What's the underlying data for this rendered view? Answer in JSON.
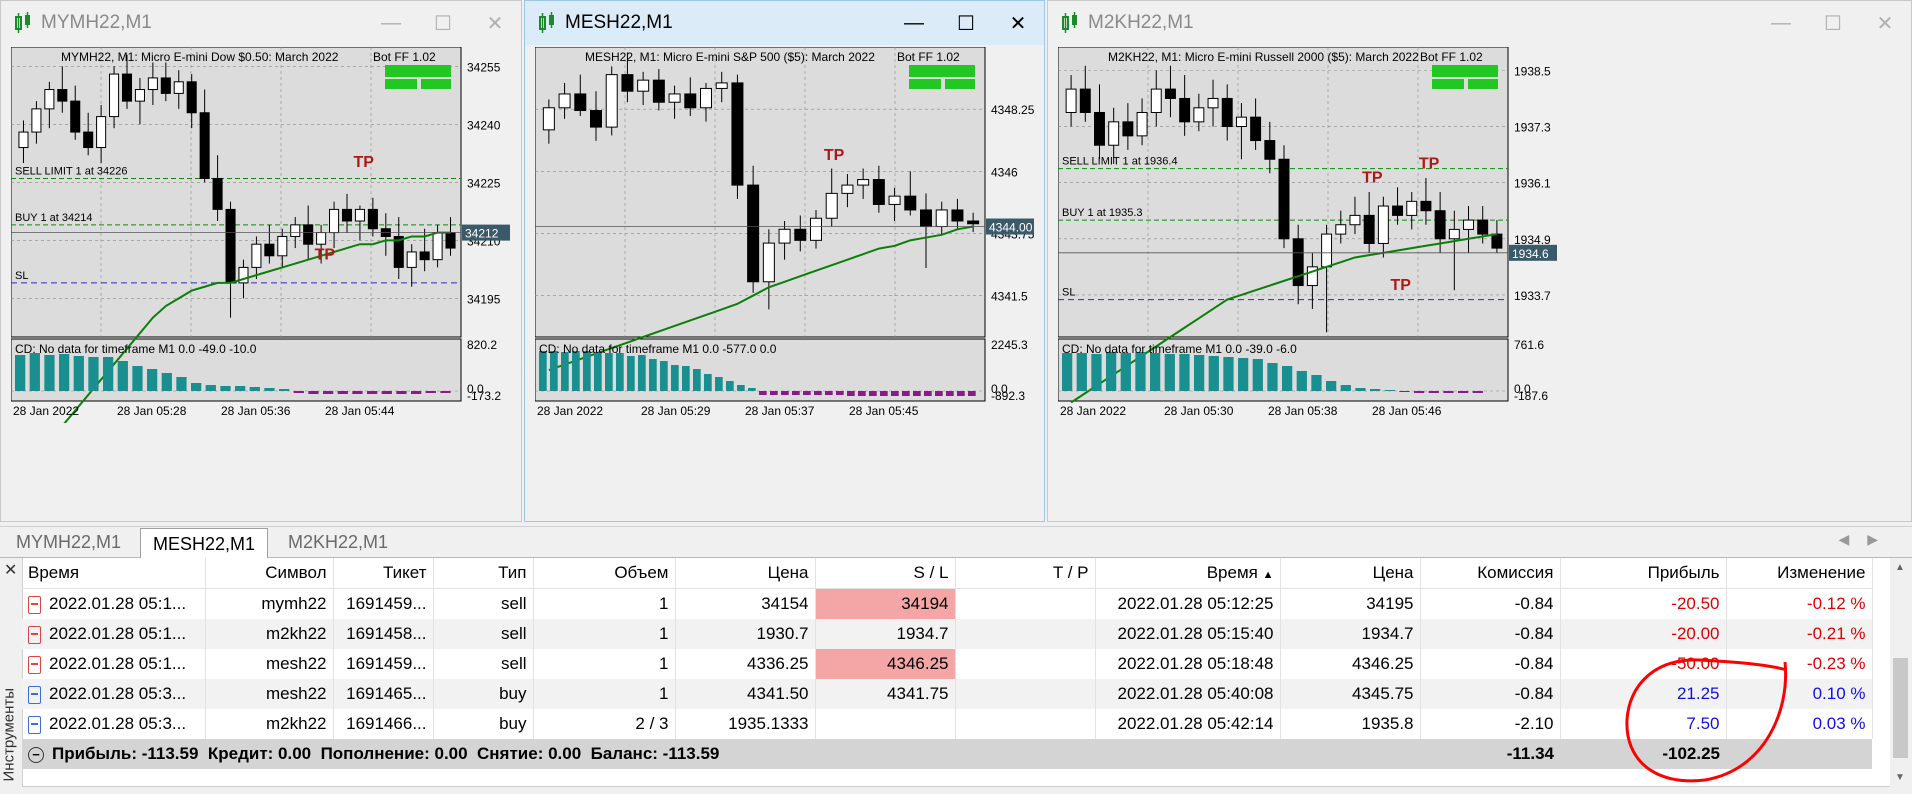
{
  "windows": [
    {
      "title": "MYMH22,M1",
      "active": false,
      "header": "MYMH22, M1:  Micro E-mini Dow $0.50: March 2022",
      "bot": "Bot FF 1.02",
      "levels": [
        {
          "label": "SELL LIMIT 1 at 34226",
          "price": 34226
        },
        {
          "label": "BUY 1 at 34214",
          "price": 34214
        },
        {
          "label": "SL",
          "price": 34199
        }
      ],
      "price_axis": {
        "min": 34185,
        "max": 34260,
        "ticks": [
          34255,
          34240,
          34225,
          34210,
          34195
        ],
        "current": "34212",
        "current_value": 34212
      },
      "tp_markers": [
        {
          "text": "TP",
          "price": 34229,
          "idx": 26
        },
        {
          "text": "TP",
          "price": 34205,
          "idx": 23
        }
      ],
      "indicator_label": "CD: No data for timeframe M1 0.0 -49.0 -10.0",
      "indicator_axis": {
        "top": "820.2",
        "mid": "0.0",
        "bottom": "-173.2"
      },
      "time_labels": [
        "28 Jan 2022",
        "28 Jan 05:28",
        "28 Jan 05:36",
        "28 Jan 05:44"
      ],
      "candles": [
        [
          34234,
          34241,
          34230,
          34238
        ],
        [
          34238,
          34246,
          34235,
          34244
        ],
        [
          34244,
          34251,
          34239,
          34249
        ],
        [
          34249,
          34255,
          34243,
          34246
        ],
        [
          34246,
          34250,
          34236,
          34238
        ],
        [
          34238,
          34243,
          34232,
          34234
        ],
        [
          34234,
          34245,
          34230,
          34242
        ],
        [
          34242,
          34255,
          34239,
          34253
        ],
        [
          34253,
          34258,
          34244,
          34246
        ],
        [
          34246,
          34252,
          34240,
          34249
        ],
        [
          34249,
          34256,
          34245,
          34252
        ],
        [
          34252,
          34256,
          34246,
          34248
        ],
        [
          34248,
          34254,
          34244,
          34251
        ],
        [
          34251,
          34253,
          34239,
          34243
        ],
        [
          34243,
          34249,
          34225,
          34226
        ],
        [
          34226,
          34232,
          34215,
          34218
        ],
        [
          34218,
          34220,
          34190,
          34199
        ],
        [
          34199,
          34205,
          34195,
          34203
        ],
        [
          34203,
          34211,
          34200,
          34209
        ],
        [
          34209,
          34214,
          34204,
          34206
        ],
        [
          34206,
          34213,
          34203,
          34211
        ],
        [
          34211,
          34216,
          34208,
          34214
        ],
        [
          34214,
          34219,
          34205,
          34209
        ],
        [
          34209,
          34214,
          34204,
          34212
        ],
        [
          34212,
          34220,
          34208,
          34218
        ],
        [
          34218,
          34222,
          34212,
          34215
        ],
        [
          34215,
          34219,
          34210,
          34218
        ],
        [
          34218,
          34221,
          34211,
          34213
        ],
        [
          34213,
          34217,
          34206,
          34211
        ],
        [
          34211,
          34216,
          34200,
          34203
        ],
        [
          34203,
          34209,
          34198,
          34207
        ],
        [
          34207,
          34213,
          34202,
          34205
        ],
        [
          34205,
          34214,
          34203,
          34212
        ],
        [
          34212,
          34216,
          34206,
          34208
        ]
      ],
      "ma": [
        34150,
        34154,
        34158,
        34162,
        34166,
        34170,
        34174,
        34178,
        34182,
        34186,
        34190,
        34193,
        34195,
        34197,
        34198,
        34199,
        34199,
        34200,
        34201,
        34202,
        34203,
        34204,
        34205,
        34206,
        34207,
        34208,
        34209,
        34209,
        34210,
        34210,
        34211,
        34211,
        34212,
        34212
      ],
      "histogram": [
        36,
        38,
        36,
        37,
        35,
        34,
        34,
        30,
        25,
        22,
        18,
        14,
        8,
        6,
        5,
        5,
        4,
        3,
        2,
        -2,
        -3,
        -3,
        -3,
        -3,
        -3,
        -3,
        -3,
        -3,
        -2,
        -2
      ]
    },
    {
      "title": "MESH22,M1",
      "active": true,
      "header": "MESH22, M1:  Micro E-mini S&P 500 ($5): March 2022",
      "bot": "Bot FF 1.02",
      "levels": [],
      "price_axis": {
        "min": 4340.0,
        "max": 4350.5,
        "ticks": [
          4348.25,
          4346.0,
          4343.75,
          4341.5
        ],
        "current": "4344.00",
        "current_value": 4344.0
      },
      "tp_markers": [
        {
          "text": "TP",
          "price": 4346.4,
          "idx": 18
        }
      ],
      "indicator_label": "CD: No data for timeframe M1 0.0 -577.0 0.0",
      "indicator_axis": {
        "top": "2245.3",
        "mid": "0.0",
        "bottom": "-892.3"
      },
      "time_labels": [
        "28 Jan 2022",
        "28 Jan 05:29",
        "28 Jan 05:37",
        "28 Jan 05:45"
      ],
      "candles": [
        [
          4347.5,
          4348.6,
          4347.0,
          4348.3
        ],
        [
          4348.3,
          4349.2,
          4347.9,
          4348.8
        ],
        [
          4348.8,
          4349.5,
          4348.0,
          4348.2
        ],
        [
          4348.2,
          4348.9,
          4347.1,
          4347.6
        ],
        [
          4347.6,
          4349.8,
          4347.3,
          4349.5
        ],
        [
          4349.5,
          4350.3,
          4348.5,
          4348.9
        ],
        [
          4348.9,
          4349.6,
          4348.4,
          4349.3
        ],
        [
          4349.3,
          4349.7,
          4348.2,
          4348.5
        ],
        [
          4348.5,
          4349.1,
          4347.9,
          4348.8
        ],
        [
          4348.8,
          4349.4,
          4348.0,
          4348.3
        ],
        [
          4348.3,
          4349.2,
          4347.8,
          4349.0
        ],
        [
          4349.0,
          4349.6,
          4348.5,
          4349.2
        ],
        [
          4349.2,
          4349.5,
          4345.0,
          4345.5
        ],
        [
          4345.5,
          4346.2,
          4341.6,
          4342.0
        ],
        [
          4342.0,
          4343.9,
          4341.0,
          4343.4
        ],
        [
          4343.4,
          4344.2,
          4342.8,
          4343.9
        ],
        [
          4343.9,
          4344.4,
          4343.1,
          4343.5
        ],
        [
          4343.5,
          4344.6,
          4343.2,
          4344.3
        ],
        [
          4344.3,
          4346.1,
          4344.0,
          4345.2
        ],
        [
          4345.2,
          4345.9,
          4344.7,
          4345.5
        ],
        [
          4345.5,
          4346.1,
          4345.0,
          4345.7
        ],
        [
          4345.7,
          4346.2,
          4344.5,
          4344.8
        ],
        [
          4344.8,
          4345.4,
          4344.2,
          4345.1
        ],
        [
          4345.1,
          4346.0,
          4344.4,
          4344.6
        ],
        [
          4344.6,
          4345.2,
          4342.5,
          4344.0
        ],
        [
          4344.0,
          4344.9,
          4343.7,
          4344.6
        ],
        [
          4344.6,
          4345.0,
          4343.9,
          4344.2
        ],
        [
          4344.2,
          4344.5,
          4343.8,
          4344.1
        ]
      ],
      "ma": [
        4338.8,
        4339.0,
        4339.2,
        4339.4,
        4339.6,
        4339.8,
        4340.0,
        4340.2,
        4340.4,
        4340.6,
        4340.8,
        4341.0,
        4341.2,
        4341.5,
        4341.8,
        4342.0,
        4342.2,
        4342.4,
        4342.6,
        4342.8,
        4343.0,
        4343.2,
        4343.3,
        4343.5,
        4343.6,
        4343.7,
        4343.9,
        4344.0
      ],
      "histogram": [
        40,
        40,
        39,
        40,
        40,
        39,
        38,
        38,
        35,
        36,
        32,
        30,
        26,
        25,
        22,
        17,
        14,
        10,
        6,
        3,
        -4,
        -4,
        -4,
        -4,
        -4,
        -4,
        -4,
        -4,
        -5,
        -5,
        -5,
        -5,
        -5,
        -5,
        -5,
        -5,
        -5,
        -5,
        -5,
        -5
      ]
    },
    {
      "title": "M2KH22,M1",
      "active": false,
      "header": "M2KH22, M1:  Micro E-mini Russell 2000 ($5): March 2022",
      "bot": "Bot FF 1.02",
      "levels": [
        {
          "label": "SELL LIMIT 1 at 1936.4",
          "price": 1936.4
        },
        {
          "label": "BUY 1 at 1935.3",
          "price": 1935.3
        },
        {
          "label": "SL",
          "price": 1933.6
        }
      ],
      "price_axis": {
        "min": 1932.8,
        "max": 1939.0,
        "ticks": [
          1938.5,
          1937.3,
          1936.1,
          1934.9,
          1933.7
        ],
        "current": "1934.6",
        "current_value": 1934.6
      },
      "tp_markers": [
        {
          "text": "TP",
          "price": 1936.1,
          "idx": 21
        },
        {
          "text": "TP",
          "price": 1936.4,
          "idx": 25
        },
        {
          "text": "TP",
          "price": 1933.8,
          "idx": 23
        }
      ],
      "indicator_label": "CD: No data for timeframe M1 0.0 -39.0 -6.0",
      "indicator_axis": {
        "top": "761.6",
        "mid": "0.0",
        "bottom": "-187.6"
      },
      "time_labels": [
        "28 Jan 2022",
        "28 Jan 05:30",
        "28 Jan 05:38",
        "28 Jan 05:46"
      ],
      "candles": [
        [
          1937.6,
          1938.4,
          1937.3,
          1938.1
        ],
        [
          1938.1,
          1938.6,
          1937.4,
          1937.6
        ],
        [
          1937.6,
          1938.2,
          1936.6,
          1936.9
        ],
        [
          1936.9,
          1937.7,
          1936.5,
          1937.4
        ],
        [
          1937.4,
          1937.8,
          1936.8,
          1937.1
        ],
        [
          1937.1,
          1937.9,
          1936.9,
          1937.6
        ],
        [
          1937.6,
          1938.5,
          1937.3,
          1938.1
        ],
        [
          1938.1,
          1938.6,
          1937.5,
          1937.9
        ],
        [
          1937.9,
          1938.4,
          1937.1,
          1937.4
        ],
        [
          1937.4,
          1938.0,
          1937.2,
          1937.7
        ],
        [
          1937.7,
          1938.3,
          1937.3,
          1937.9
        ],
        [
          1937.9,
          1938.2,
          1937.0,
          1937.3
        ],
        [
          1937.3,
          1937.8,
          1936.6,
          1937.5
        ],
        [
          1937.5,
          1937.9,
          1936.8,
          1937.0
        ],
        [
          1937.0,
          1937.4,
          1936.3,
          1936.6
        ],
        [
          1936.6,
          1936.9,
          1934.7,
          1934.9
        ],
        [
          1934.9,
          1935.2,
          1933.5,
          1933.9
        ],
        [
          1933.9,
          1934.6,
          1933.4,
          1934.3
        ],
        [
          1934.3,
          1935.2,
          1932.9,
          1935.0
        ],
        [
          1935.0,
          1935.5,
          1934.8,
          1935.2
        ],
        [
          1935.2,
          1935.8,
          1935.0,
          1935.4
        ],
        [
          1935.4,
          1935.9,
          1934.6,
          1934.8
        ],
        [
          1934.8,
          1935.8,
          1934.5,
          1935.6
        ],
        [
          1935.6,
          1936.0,
          1935.2,
          1935.4
        ],
        [
          1935.4,
          1935.9,
          1935.1,
          1935.7
        ],
        [
          1935.7,
          1936.2,
          1935.2,
          1935.5
        ],
        [
          1935.5,
          1935.9,
          1934.6,
          1934.9
        ],
        [
          1934.9,
          1935.5,
          1933.8,
          1935.1
        ],
        [
          1935.1,
          1935.6,
          1934.6,
          1935.3
        ],
        [
          1935.3,
          1935.6,
          1934.8,
          1935.0
        ],
        [
          1935.0,
          1935.3,
          1934.6,
          1934.7
        ]
      ],
      "ma": [
        1931.4,
        1931.6,
        1931.8,
        1932.0,
        1932.2,
        1932.4,
        1932.6,
        1932.8,
        1933.0,
        1933.2,
        1933.4,
        1933.6,
        1933.7,
        1933.8,
        1933.9,
        1934.0,
        1934.1,
        1934.2,
        1934.3,
        1934.4,
        1934.5,
        1934.55,
        1934.6,
        1934.65,
        1934.7,
        1934.75,
        1934.8,
        1934.85,
        1934.9,
        1934.95,
        1935.0
      ],
      "histogram": [
        38,
        38,
        37,
        39,
        38,
        39,
        38,
        37,
        37,
        36,
        35,
        34,
        33,
        32,
        28,
        25,
        20,
        16,
        10,
        6,
        3,
        2,
        1,
        -1,
        -2,
        -2,
        -2,
        -2,
        -2
      ]
    }
  ],
  "tabs": [
    "MYMH22,M1",
    "MESH22,M1",
    "M2KH22,M1"
  ],
  "active_tab": 1,
  "side_label": "Инструменты",
  "table": {
    "columns": [
      "Время",
      "Символ",
      "Тикет",
      "Тип",
      "Объем",
      "Цена",
      "S / L",
      "T / P",
      "Время",
      "Цена",
      "Комиссия",
      "Прибыль",
      "Изменение"
    ],
    "rows": [
      {
        "type_icon": "sell",
        "time": "2022.01.28 05:1...",
        "symbol": "mymh22",
        "ticket": "1691459...",
        "type": "sell",
        "volume": "1",
        "price": "34154",
        "sl": "34194",
        "tp": "",
        "close_time": "2022.01.28 05:12:25",
        "close_price": "34195",
        "commission": "-0.84",
        "profit": "-20.50",
        "change": "-0.12 %"
      },
      {
        "type_icon": "sell",
        "time": "2022.01.28 05:1...",
        "symbol": "m2kh22",
        "ticket": "1691458...",
        "type": "sell",
        "volume": "1",
        "price": "1930.7",
        "sl": "1934.7",
        "tp": "",
        "close_time": "2022.01.28 05:15:40",
        "close_price": "1934.7",
        "commission": "-0.84",
        "profit": "-20.00",
        "change": "-0.21 %"
      },
      {
        "type_icon": "sell",
        "time": "2022.01.28 05:1...",
        "symbol": "mesh22",
        "ticket": "1691459...",
        "type": "sell",
        "volume": "1",
        "price": "4336.25",
        "sl": "4346.25",
        "tp": "",
        "close_time": "2022.01.28 05:18:48",
        "close_price": "4346.25",
        "commission": "-0.84",
        "profit": "-50.00",
        "change": "-0.23 %"
      },
      {
        "type_icon": "buy",
        "time": "2022.01.28 05:3...",
        "symbol": "mesh22",
        "ticket": "1691465...",
        "type": "buy",
        "volume": "1",
        "price": "4341.50",
        "sl": "4341.75",
        "tp": "",
        "close_time": "2022.01.28 05:40:08",
        "close_price": "4345.75",
        "commission": "-0.84",
        "profit": "21.25",
        "change": "0.10 %"
      },
      {
        "type_icon": "buy",
        "time": "2022.01.28 05:3...",
        "symbol": "m2kh22",
        "ticket": "1691466...",
        "type": "buy",
        "volume": "2 / 3",
        "price": "1935.1333",
        "sl": "",
        "tp": "",
        "close_time": "2022.01.28 05:42:14",
        "close_price": "1935.8",
        "commission": "-2.10",
        "profit": "7.50",
        "change": "0.03 %"
      }
    ],
    "summary": {
      "text": "Прибыль: -113.59  Кредит: 0.00  Пополнение: 0.00  Снятие: 0.00  Баланс: -113.59",
      "commission": "-11.34",
      "profit": "-102.25"
    }
  },
  "colors": {
    "bull": "#ffffff",
    "bear": "#000000",
    "ma": "#0a7f0a",
    "histogram_pos": "#1a8f8f",
    "histogram_neg": "#8a1a8a",
    "tp": "#b01818",
    "loss_cell": "#f4a6a6",
    "neg_text": "#e00000",
    "pos_text": "#1010e0",
    "annotation": "#ff0000"
  }
}
